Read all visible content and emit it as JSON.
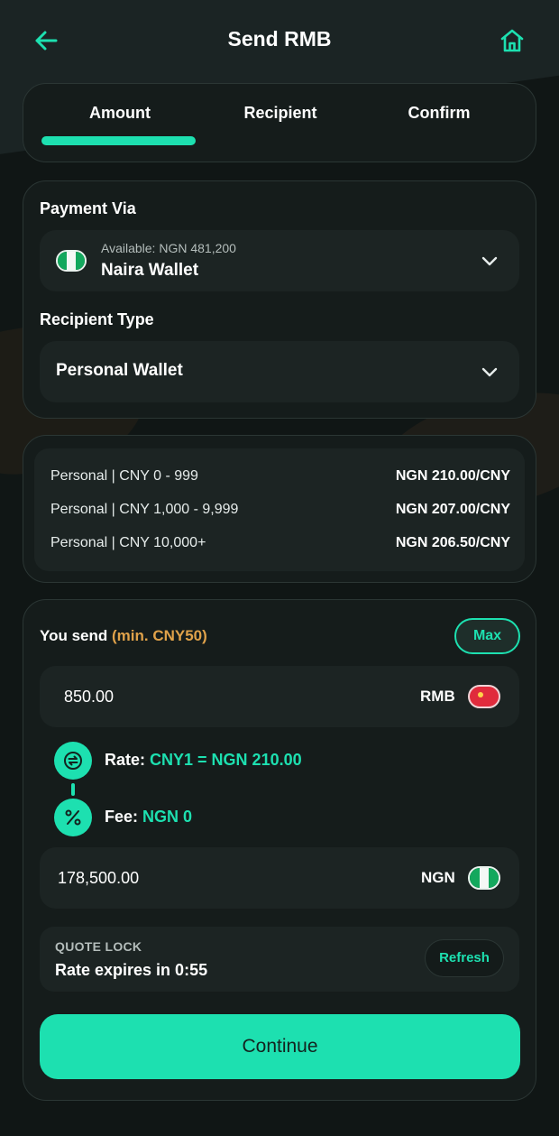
{
  "header": {
    "title": "Send RMB",
    "back_icon": "arrow-left-icon",
    "home_icon": "home-icon"
  },
  "tabs": [
    {
      "label": "Amount",
      "active": true
    },
    {
      "label": "Recipient",
      "active": false
    },
    {
      "label": "Confirm",
      "active": false
    }
  ],
  "payment": {
    "label": "Payment Via",
    "available": "Available: NGN 481,200",
    "wallet": "Naira Wallet"
  },
  "recipient_type": {
    "label": "Recipient Type",
    "value": "Personal Wallet"
  },
  "rates": [
    {
      "tier": "Personal | CNY 0 - 999",
      "rate": "NGN 210.00/CNY"
    },
    {
      "tier": "Personal | CNY 1,000 - 9,999",
      "rate": "NGN 207.00/CNY"
    },
    {
      "tier": "Personal | CNY 10,000+",
      "rate": "NGN 206.50/CNY"
    }
  ],
  "send": {
    "label": "You send",
    "min": "(min. CNY50)",
    "max_label": "Max",
    "amount": "850.00",
    "currency": "RMB",
    "rate_label": "Rate:",
    "rate_value": "CNY1 = NGN 210.00",
    "fee_label": "Fee:",
    "fee_value": "NGN 0",
    "receive_amount": "178,500.00",
    "receive_currency": "NGN"
  },
  "quote": {
    "label": "QUOTE LOCK",
    "expiry": "Rate expires in 0:55",
    "refresh_label": "Refresh"
  },
  "continue_label": "Continue",
  "colors": {
    "accent": "#1de0b0",
    "min_text": "#e0a24a",
    "background": "#101615",
    "card": "#151c1b"
  }
}
